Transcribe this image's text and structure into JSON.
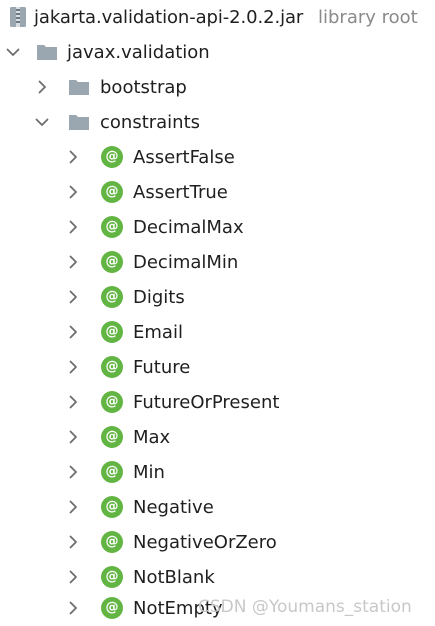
{
  "root": {
    "label": "jakarta.validation-api-2.0.2.jar",
    "suffix": "library root",
    "icon": "jar-archive-icon"
  },
  "package": {
    "label": "javax.validation",
    "expanded": true,
    "icon": "package-folder-icon"
  },
  "subpackages": [
    {
      "label": "bootstrap",
      "expanded": false,
      "icon": "package-folder-icon"
    },
    {
      "label": "constraints",
      "expanded": true,
      "icon": "package-folder-icon"
    }
  ],
  "annotations": {
    "icon": "annotation-icon",
    "icon_glyph": "@",
    "items": [
      "AssertFalse",
      "AssertTrue",
      "DecimalMax",
      "DecimalMin",
      "Digits",
      "Email",
      "Future",
      "FutureOrPresent",
      "Max",
      "Min",
      "Negative",
      "NegativeOrZero",
      "NotBlank",
      "NotEmpty"
    ]
  },
  "watermark": "CSDN @Youmans_station",
  "colors": {
    "annotation_icon": "#62b543",
    "folder_icon": "#9aa7b0",
    "chevron": "#6e6e6e",
    "secondary_text": "#8a8a8a",
    "text": "#1f1f1f"
  }
}
